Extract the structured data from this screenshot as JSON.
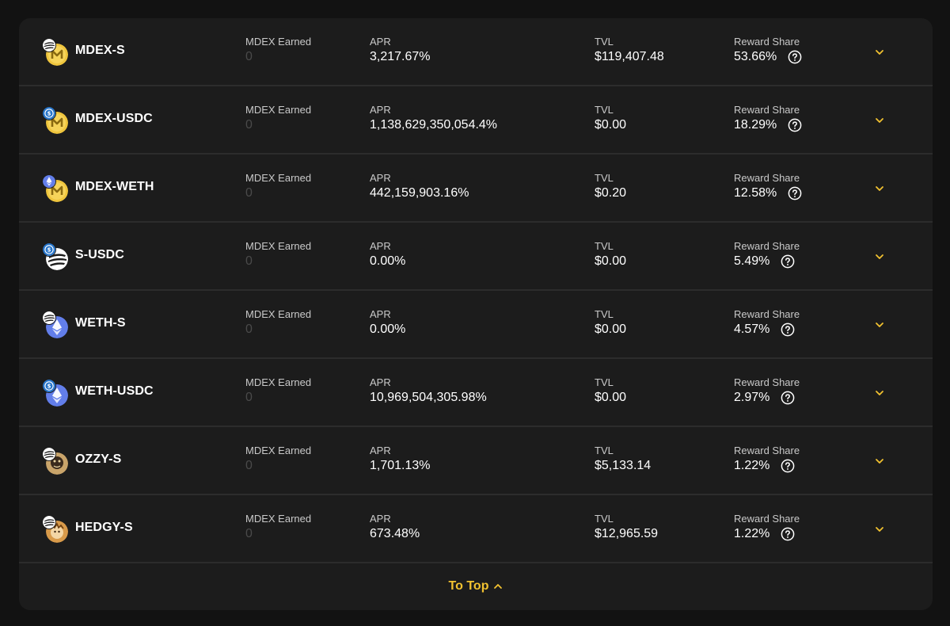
{
  "colors": {
    "accent": "#f2c230",
    "panel": "#1c1c1c",
    "background": "#121212",
    "muted": "#4a4a4a"
  },
  "columns": {
    "earned": "MDEX Earned",
    "apr": "APR",
    "tvl": "TVL",
    "share": "Reward Share"
  },
  "farms": [
    {
      "name": "MDEX-S",
      "main_icon": "mdex-token-icon",
      "sub_icon": "sonic-token-icon",
      "earned": "0",
      "apr": "3,217.67%",
      "tvl": "$119,407.48",
      "share": "53.66%"
    },
    {
      "name": "MDEX-USDC",
      "main_icon": "mdex-token-icon",
      "sub_icon": "usdc-token-icon",
      "earned": "0",
      "apr": "1,138,629,350,054.4%",
      "tvl": "$0.00",
      "share": "18.29%"
    },
    {
      "name": "MDEX-WETH",
      "main_icon": "mdex-token-icon",
      "sub_icon": "weth-token-icon",
      "earned": "0",
      "apr": "442,159,903.16%",
      "tvl": "$0.20",
      "share": "12.58%"
    },
    {
      "name": "S-USDC",
      "main_icon": "sonic-token-icon",
      "sub_icon": "usdc-token-icon",
      "earned": "0",
      "apr": "0.00%",
      "tvl": "$0.00",
      "share": "5.49%"
    },
    {
      "name": "WETH-S",
      "main_icon": "weth-token-icon",
      "sub_icon": "sonic-token-icon",
      "earned": "0",
      "apr": "0.00%",
      "tvl": "$0.00",
      "share": "4.57%"
    },
    {
      "name": "WETH-USDC",
      "main_icon": "weth-token-icon",
      "sub_icon": "usdc-token-icon",
      "earned": "0",
      "apr": "10,969,504,305.98%",
      "tvl": "$0.00",
      "share": "2.97%"
    },
    {
      "name": "OZZY-S",
      "main_icon": "ozzy-token-icon",
      "sub_icon": "sonic-token-icon",
      "earned": "0",
      "apr": "1,701.13%",
      "tvl": "$5,133.14",
      "share": "1.22%"
    },
    {
      "name": "HEDGY-S",
      "main_icon": "hedgy-token-icon",
      "sub_icon": "sonic-token-icon",
      "earned": "0",
      "apr": "673.48%",
      "tvl": "$12,965.59",
      "share": "1.22%"
    }
  ],
  "footer": {
    "to_top_label": "To Top"
  }
}
